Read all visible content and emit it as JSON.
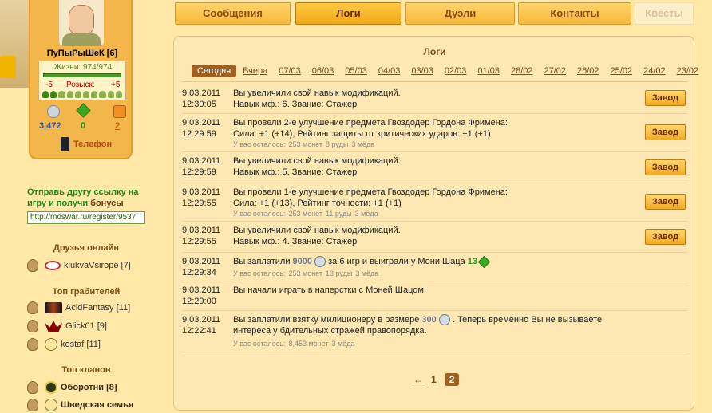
{
  "player": {
    "name": "ПуПыРыШеК [6]",
    "hp_label": "Жизни: 974/974",
    "hp_fraction": 1.0,
    "wanted_low": "-5",
    "wanted_label": "Розыск:",
    "wanted_high": "+5",
    "money": "3,472",
    "ore": "0",
    "honey": "2",
    "phone": "Телефон"
  },
  "invite": {
    "line1": "Отправь другу ссылку на игру и получи",
    "bonus_link": "бонусы",
    "url": "http://moswar.ru/register/9537"
  },
  "friends": {
    "title": "Друзья онлайн",
    "items": [
      {
        "name": "klukvaVsirope",
        "count": "[7]"
      }
    ]
  },
  "robbers": {
    "title": "Топ грабителей",
    "items": [
      {
        "name": "AcidFantasy",
        "count": "[11]"
      },
      {
        "name": "Glick01",
        "count": "[9]"
      },
      {
        "name": "kostaf",
        "count": "[11]"
      }
    ]
  },
  "clans": {
    "title": "Топ кланов",
    "items": [
      {
        "name": "Оборотни [8]"
      },
      {
        "name": "Шведская семья"
      }
    ]
  },
  "tabs": [
    {
      "label": "Сообщения"
    },
    {
      "label": "Логи"
    },
    {
      "label": "Дуэли"
    },
    {
      "label": "Контакты"
    },
    {
      "label": "Квесты"
    }
  ],
  "main": {
    "title": "Логи",
    "dates": [
      "Сегодня",
      "Вчера",
      "07/03",
      "06/03",
      "05/03",
      "04/03",
      "03/03",
      "02/03",
      "01/03",
      "28/02",
      "27/02",
      "26/02",
      "25/02",
      "24/02",
      "23/02"
    ],
    "logs": [
      {
        "date": "9.03.2011",
        "time": "12:30:05",
        "line1": "Вы увеличили свой навык модификаций.",
        "line2": "Навык мф.: 6. Звание: Стажер",
        "button": "Завод"
      },
      {
        "date": "9.03.2011",
        "time": "12:29:59",
        "line1": "Вы провели 2-е улучшение предмета Гвоздодер Гордона Фримена:",
        "line2": "Сила: +1 (+14), Рейтинг защиты от критических ударов: +1 (+1)",
        "sub_label": "У вас осталось:",
        "sub_money": "253 монет",
        "sub_ore": "8 руды",
        "sub_honey": "3 мёда",
        "button": "Завод"
      },
      {
        "date": "9.03.2011",
        "time": "12:29:59",
        "line1": "Вы увеличили свой навык модификаций.",
        "line2": "Навык мф.: 5. Звание: Стажер",
        "button": "Завод"
      },
      {
        "date": "9.03.2011",
        "time": "12:29:55",
        "line1": "Вы провели 1-е улучшение предмета Гвоздодер Гордона Фримена:",
        "line2": "Сила: +1 (+13), Рейтинг точности: +1 (+1)",
        "sub_label": "У вас осталось:",
        "sub_money": "253 монет",
        "sub_ore": "11 руды",
        "sub_honey": "3 мёда",
        "button": "Завод"
      },
      {
        "date": "9.03.2011",
        "time": "12:29:55",
        "line1": "Вы увеличили свой навык модификаций.",
        "line2": "Навык мф.: 4. Звание: Стажер",
        "button": "Завод"
      },
      {
        "date": "9.03.2011",
        "time": "12:29:34",
        "line1a": "Вы заплатили",
        "money": "9000",
        "line1b": "за 6 игр и выиграли у Мони Шаца",
        "ore": "13",
        "sub_label": "У вас осталось:",
        "sub_money": "253 монет",
        "sub_ore": "13 руды",
        "sub_honey": "3 мёда"
      },
      {
        "date": "9.03.2011",
        "time": "12:29:00",
        "line1": "Вы начали играть в наперстки с Моней Шацом."
      },
      {
        "date": "9.03.2011",
        "time": "12:22:41",
        "line1a": "Вы заплатили взятку милиционеру в размере",
        "money": "300",
        "line1b": ". Теперь временно Вы не вызываете",
        "line2": "интереса у бдительных стражей правопорядка.",
        "sub_label": "У вас осталось:",
        "sub_money": "8,453 монет",
        "sub_honey": "3 мёда"
      }
    ],
    "pager": {
      "prev": "←",
      "p1": "1",
      "p2": "2"
    }
  }
}
